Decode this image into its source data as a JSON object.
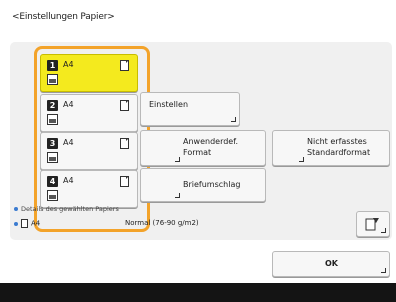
{
  "header": {
    "title": "<Einstellungen Papier>"
  },
  "drawers": [
    {
      "number": "1",
      "size": "A4",
      "selected": true
    },
    {
      "number": "2",
      "size": "A4",
      "selected": false
    },
    {
      "number": "3",
      "size": "A4",
      "selected": false
    },
    {
      "number": "4",
      "size": "A4",
      "selected": false
    }
  ],
  "buttons": {
    "einstellen": "Einstellen",
    "custom_format": "Anwenderdef.\nFormat",
    "not_registered": "Nicht erfasstes\nStandardformat",
    "envelope": "Briefumschlag",
    "ok": "OK"
  },
  "details": {
    "label": "Details des gewählten Papiers",
    "size": "A4",
    "type": "Normal (76-90 g/m2)"
  },
  "icons": {
    "paper_settings": "paper-settings-icon"
  },
  "colors": {
    "selection_border": "#f3a32a",
    "selected_drawer": "#f4ea1e"
  }
}
